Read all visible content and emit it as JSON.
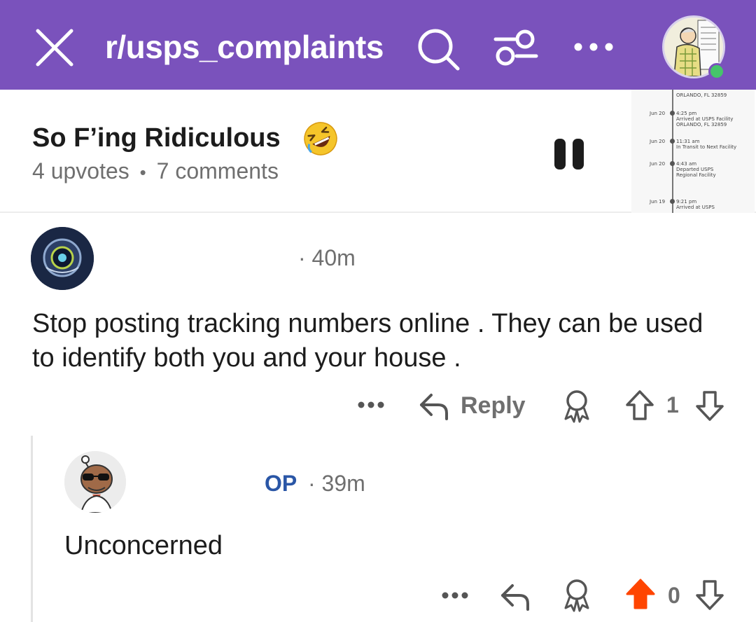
{
  "header": {
    "subreddit": "r/usps_complaints",
    "bg_color": "#7a52bc",
    "icons": [
      "close-icon",
      "search-icon",
      "filter-icon",
      "more-icon",
      "avatar"
    ]
  },
  "post": {
    "title": "So F’ing Ridiculous",
    "title_emoji": "rolling-on-floor-laughing-emoji",
    "upvotes": "4 upvotes",
    "separator": "•",
    "comments": "7 comments",
    "thumbnail": {
      "top_text": "ORLANDO, FL 32859",
      "events": [
        {
          "date": "Jun 20",
          "time": "4:25 pm",
          "line1": "Arrived at USPS Facility",
          "line2": "ORLANDO, FL 32859"
        },
        {
          "date": "Jun 20",
          "time": "11:31 am",
          "line1": "In Transit to Next Facility",
          "line2": ""
        },
        {
          "date": "Jun 20",
          "time": "4:43 am",
          "line1": "Departed USPS",
          "line2": "Regional Facility"
        },
        {
          "date": "Jun 19",
          "time": "9:21 pm",
          "line1": "Arrived at USPS",
          "line2": ""
        }
      ]
    }
  },
  "comments": [
    {
      "time": "· 40m",
      "body": "Stop posting tracking numbers online . They can be used to identify both you and your house .",
      "reply_label": "Reply",
      "score": "1"
    },
    {
      "op_label": "OP",
      "time": "· 39m",
      "body": "Unconcerned",
      "score": "0",
      "upvoted_color": "#ff4500"
    }
  ]
}
